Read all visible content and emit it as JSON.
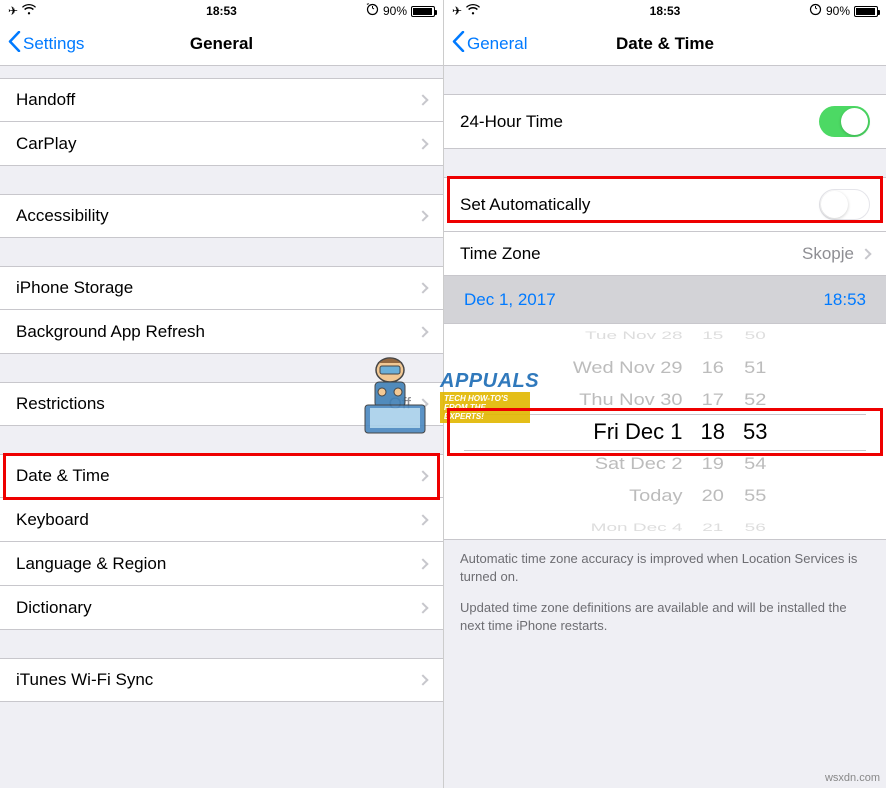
{
  "statusbar": {
    "time": "18:53",
    "battery_percent": "90%",
    "airplane_icon": "airplane",
    "wifi_icon": "wifi",
    "rotation_lock_icon": "rotation-lock"
  },
  "left": {
    "back_label": "Settings",
    "title": "General",
    "groups": [
      {
        "rows": [
          {
            "label": "Handoff"
          },
          {
            "label": "CarPlay"
          }
        ]
      },
      {
        "rows": [
          {
            "label": "Accessibility"
          }
        ]
      },
      {
        "rows": [
          {
            "label": "iPhone Storage"
          },
          {
            "label": "Background App Refresh"
          }
        ]
      },
      {
        "rows": [
          {
            "label": "Restrictions",
            "value": "Off"
          }
        ]
      },
      {
        "rows": [
          {
            "label": "Date & Time"
          },
          {
            "label": "Keyboard"
          },
          {
            "label": "Language & Region"
          },
          {
            "label": "Dictionary"
          }
        ]
      },
      {
        "rows": [
          {
            "label": "iTunes Wi-Fi Sync"
          }
        ]
      }
    ]
  },
  "right": {
    "back_label": "General",
    "title": "Date & Time",
    "rows": {
      "twenty_four_hour": {
        "label": "24-Hour Time",
        "on": true
      },
      "set_automatically": {
        "label": "Set Automatically",
        "on": false
      },
      "time_zone": {
        "label": "Time Zone",
        "value": "Skopje"
      }
    },
    "date_display": {
      "date": "Dec 1, 2017",
      "time": "18:53"
    },
    "picker": {
      "dates": [
        "Tue Nov 28",
        "Wed Nov 29",
        "Thu Nov 30",
        "Fri Dec 1",
        "Sat Dec 2",
        "Today",
        "Mon Dec 4"
      ],
      "hours": [
        "15",
        "16",
        "17",
        "18",
        "19",
        "20",
        "21"
      ],
      "minutes": [
        "50",
        "51",
        "52",
        "53",
        "54",
        "55",
        "56"
      ],
      "selected_index": 3
    },
    "footer1": "Automatic time zone accuracy is improved when Location Services is turned on.",
    "footer2": "Updated time zone definitions are available and will be installed the next time iPhone restarts."
  },
  "watermark": {
    "brand": "APPUALS",
    "tagline": "TECH HOW-TO'S FROM THE EXPERTS!",
    "site": "wsxdn.com"
  }
}
